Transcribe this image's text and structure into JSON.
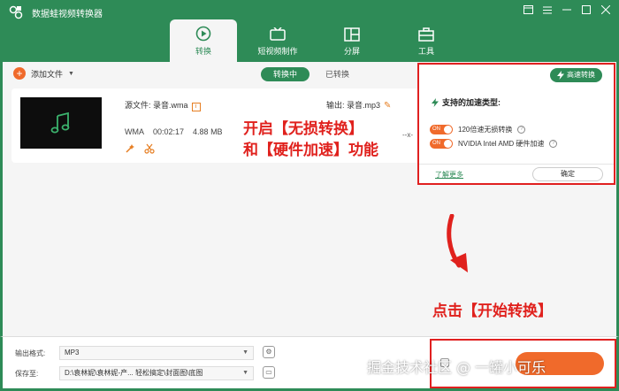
{
  "app": {
    "title": "数据蛙视频转换器"
  },
  "window_controls": [
    "min",
    "max",
    "close"
  ],
  "nav": {
    "tabs": [
      {
        "label": "转换",
        "icon": "convert-icon",
        "active": true
      },
      {
        "label": "短视频制作",
        "icon": "tv-icon",
        "active": false
      },
      {
        "label": "分屏",
        "icon": "split-screen-icon",
        "active": false
      },
      {
        "label": "工具",
        "icon": "toolbox-icon",
        "active": false
      }
    ]
  },
  "toolbar": {
    "add_file": "添加文件"
  },
  "sub_tabs": [
    {
      "label": "转换中",
      "active": true
    },
    {
      "label": "已转换",
      "active": false
    }
  ],
  "file": {
    "source_label": "源文件: 录音.wma",
    "format": "WMA",
    "duration": "00:02:17",
    "size": "4.88 MB",
    "output_label": "输出: 录音.mp3"
  },
  "annotations": {
    "line1": "开启【无损转换】",
    "line2": "和【硬件加速】功能",
    "start_hint": "点击【开始转换】"
  },
  "popup": {
    "speed_button": "高速转换",
    "heading": "支持的加速类型:",
    "row1_toggle": "ON",
    "row1_text": "120倍速无损转换",
    "row2_toggle": "ON",
    "row2_text": "NVIDIA  Intel  AMD 硬件加速",
    "learn_more": "了解更多",
    "ok": "确定"
  },
  "bottom": {
    "format_label": "输出格式:",
    "format_value": "MP3",
    "save_label": "保存至:",
    "save_value": "D:\\袁林妮\\袁林妮-产... 轻松搞定\\封面图\\底图"
  },
  "watermark": "掘金技术社区 @ 一罐小可乐",
  "colors": {
    "brand": "#2e8b57",
    "accent": "#f06a2b",
    "annotation": "#e0211d"
  }
}
